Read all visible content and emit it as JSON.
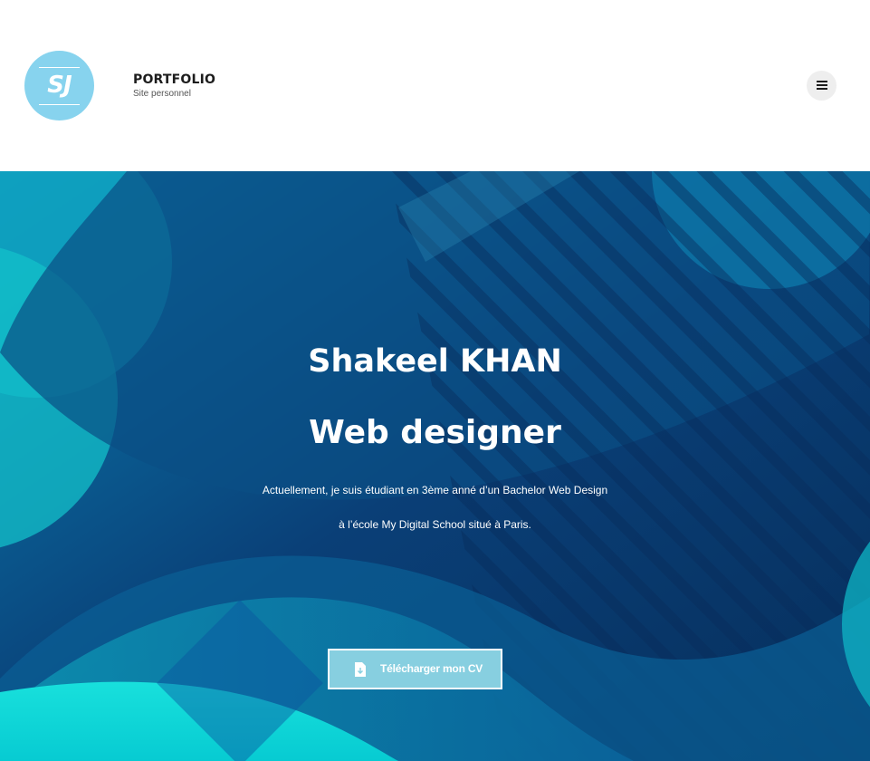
{
  "header": {
    "logo_text": "SJ",
    "brand_title": "PORTFOLIO",
    "brand_subtitle": "Site personnel",
    "menu_icon": "hamburger-menu-icon"
  },
  "hero": {
    "name": "Shakeel KHAN",
    "role": "Web designer",
    "description_line_1": "Actuellement, je suis étudiant en 3ème anné d’un Bachelor Web Design",
    "description_line_2": "à l’école My Digital School situé à Paris.",
    "cv_button_label": "Télécharger mon CV",
    "cv_button_icon": "file-download-icon"
  },
  "colors": {
    "logo_bg": "#87d3ee",
    "hero_dark": "#0a3a6e",
    "hero_teal": "#12b7c9",
    "button_bg": "#87cfe0"
  }
}
